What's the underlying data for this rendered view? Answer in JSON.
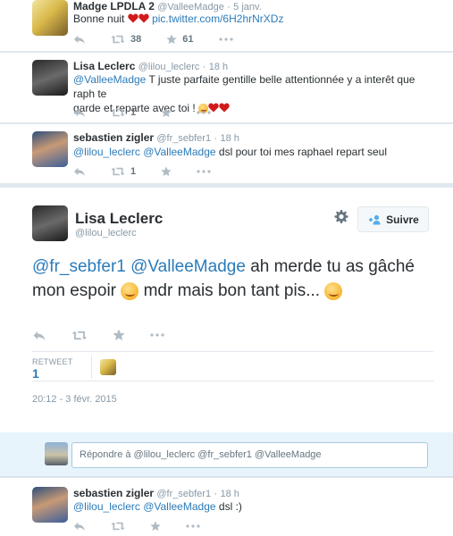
{
  "colors": {
    "link": "#2b7bb9",
    "heart": "#d11a1a",
    "muted": "#8899a6",
    "bg": "#e1e8ed"
  },
  "tweets_above": [
    {
      "name": "Madge LPDLA 2",
      "handle": "@ValleeMadge",
      "dot": "·",
      "time": "5 janv.",
      "text": "Bonne nuit",
      "emojis": [
        "heart",
        "heart"
      ],
      "link": "pic.twitter.com/6H2hrNrXDz",
      "retweets": "38",
      "favorites": "61"
    },
    {
      "name": "Lisa Leclerc",
      "handle": "@lilou_leclerc",
      "dot": "·",
      "time": "18 h",
      "mention": "@ValleeMadge",
      "text_line1": "T juste parfaite gentille belle attentionnée y a interêt que raph te",
      "text_line2": "garde et reparte avec toi !",
      "emojis": [
        "smile",
        "heart",
        "heart"
      ],
      "retweets": "1"
    },
    {
      "name": "sebastien zigler",
      "handle": "@fr_sebfer1",
      "dot": "·",
      "time": "18 h",
      "mentions": "@lilou_leclerc @ValleeMadge",
      "text": "dsl pour toi mes raphael repart seul",
      "retweets": "1"
    }
  ],
  "main_tweet": {
    "name": "Lisa Leclerc",
    "handle": "@lilou_leclerc",
    "follow_label": "Suivre",
    "mentions": "@fr_sebfer1 @ValleeMadge",
    "text_part1": "ah merde tu as gâché mon espoir",
    "text_part2": "mdr mais bon tant pis...",
    "emojis": [
      "smile",
      "smile"
    ],
    "retweet_label": "RETWEET",
    "retweet_count": "1",
    "date": "20:12 - 3 févr. 2015"
  },
  "reply_box": {
    "placeholder": "Répondre à @lilou_leclerc @fr_sebfer1 @ValleeMadge"
  },
  "tweet_below": {
    "name": "sebastien zigler",
    "handle": "@fr_sebfer1",
    "dot": "·",
    "time": "18 h",
    "mentions": "@lilou_leclerc @ValleeMadge",
    "text": "dsl :)"
  },
  "icons": [
    "reply-icon",
    "retweet-icon",
    "favorite-icon",
    "more-icon",
    "gear-icon",
    "follow-icon"
  ]
}
